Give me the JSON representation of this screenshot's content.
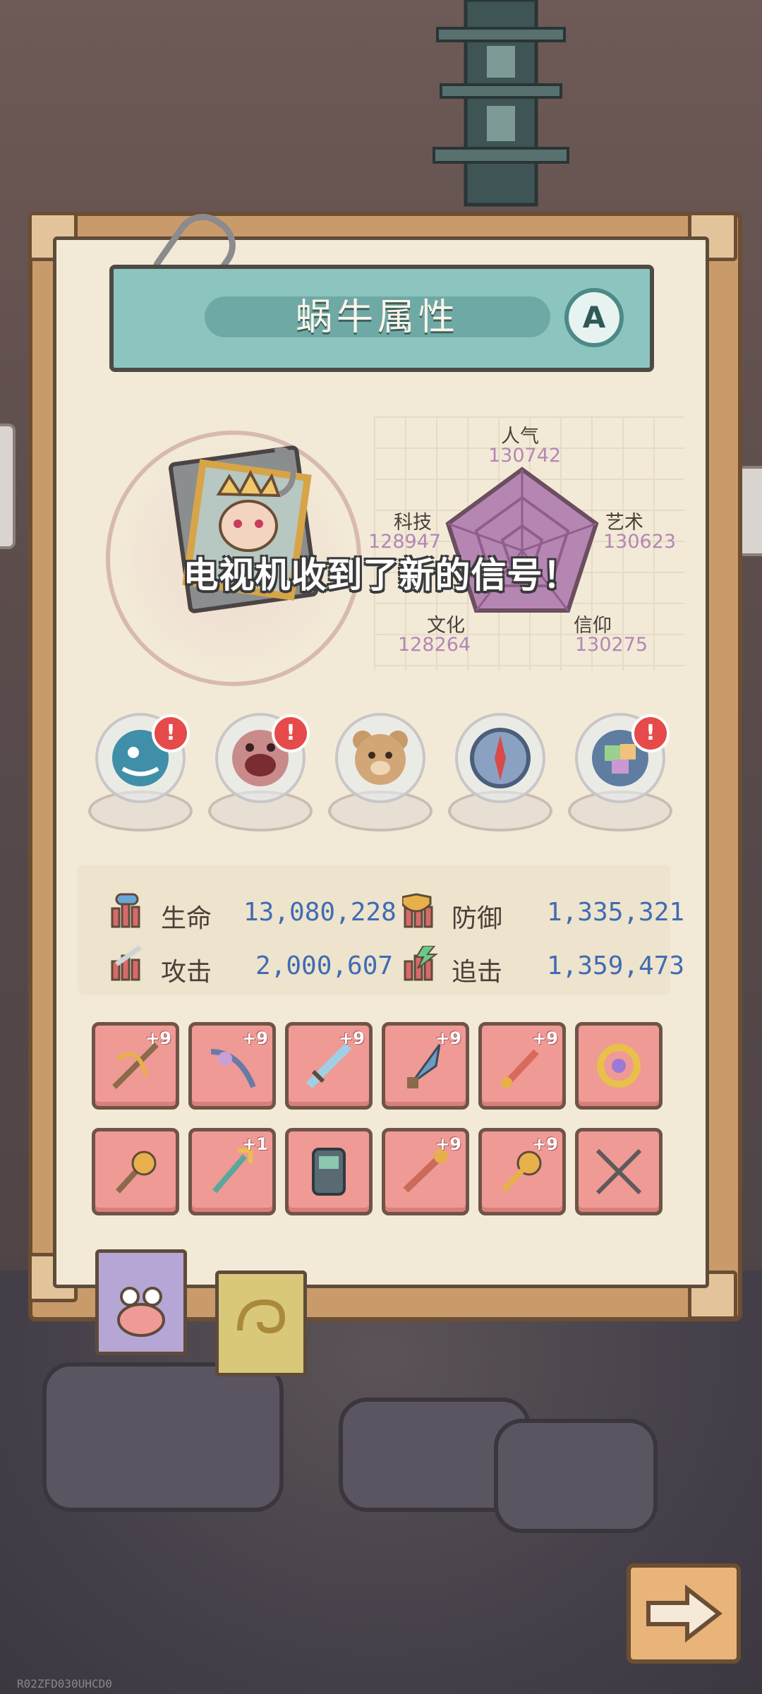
{
  "panel": {
    "title": "蜗牛属性",
    "grade": "A"
  },
  "radar": {
    "popularity": {
      "label": "人气",
      "value": "130742"
    },
    "tech": {
      "label": "科技",
      "value": "128947"
    },
    "art": {
      "label": "艺术",
      "value": "130623"
    },
    "culture": {
      "label": "文化",
      "value": "128264"
    },
    "faith": {
      "label": "信仰",
      "value": "130275"
    }
  },
  "notification": "电视机收到了新的信号！",
  "relics": [
    {
      "icon": "monster-fish-icon",
      "badge": "!"
    },
    {
      "icon": "skull-mouth-icon",
      "badge": "!"
    },
    {
      "icon": "teddy-bear-icon",
      "badge": ""
    },
    {
      "icon": "compass-icon",
      "badge": ""
    },
    {
      "icon": "gem-orb-icon",
      "badge": "!"
    }
  ],
  "stats": {
    "hp": {
      "label": "生命",
      "value": "13,080,228"
    },
    "def": {
      "label": "防御",
      "value": "1,335,321"
    },
    "atk": {
      "label": "攻击",
      "value": "2,000,607"
    },
    "chase": {
      "label": "追击",
      "value": "1,359,473"
    }
  },
  "equipment_row1": [
    {
      "icon": "crossbow-icon",
      "level": "+9"
    },
    {
      "icon": "dragon-bow-icon",
      "level": "+9"
    },
    {
      "icon": "sword-icon",
      "level": "+9"
    },
    {
      "icon": "dagger-icon",
      "level": "+9"
    },
    {
      "icon": "rocket-staff-icon",
      "level": "+9"
    },
    {
      "icon": "ring-icon",
      "level": ""
    }
  ],
  "equipment_row2": [
    {
      "icon": "mace-icon",
      "level": ""
    },
    {
      "icon": "trident-icon",
      "level": "+1"
    },
    {
      "icon": "device-icon",
      "level": ""
    },
    {
      "icon": "flail-icon",
      "level": "+9"
    },
    {
      "icon": "golden-key-icon",
      "level": "+9"
    },
    {
      "icon": "crossed-spears-icon",
      "level": ""
    }
  ],
  "tabs": [
    {
      "icon": "snail-face-icon"
    },
    {
      "icon": "shell-icon"
    }
  ],
  "next_button": {
    "icon": "arrow-right-icon"
  },
  "watermark": "R02ZFD030UHCD0",
  "colors": {
    "stat_value": "#3f6cb5",
    "radar_value": "#b486b4",
    "slot": "#ef9a95",
    "banner": "#8cc5c0"
  }
}
